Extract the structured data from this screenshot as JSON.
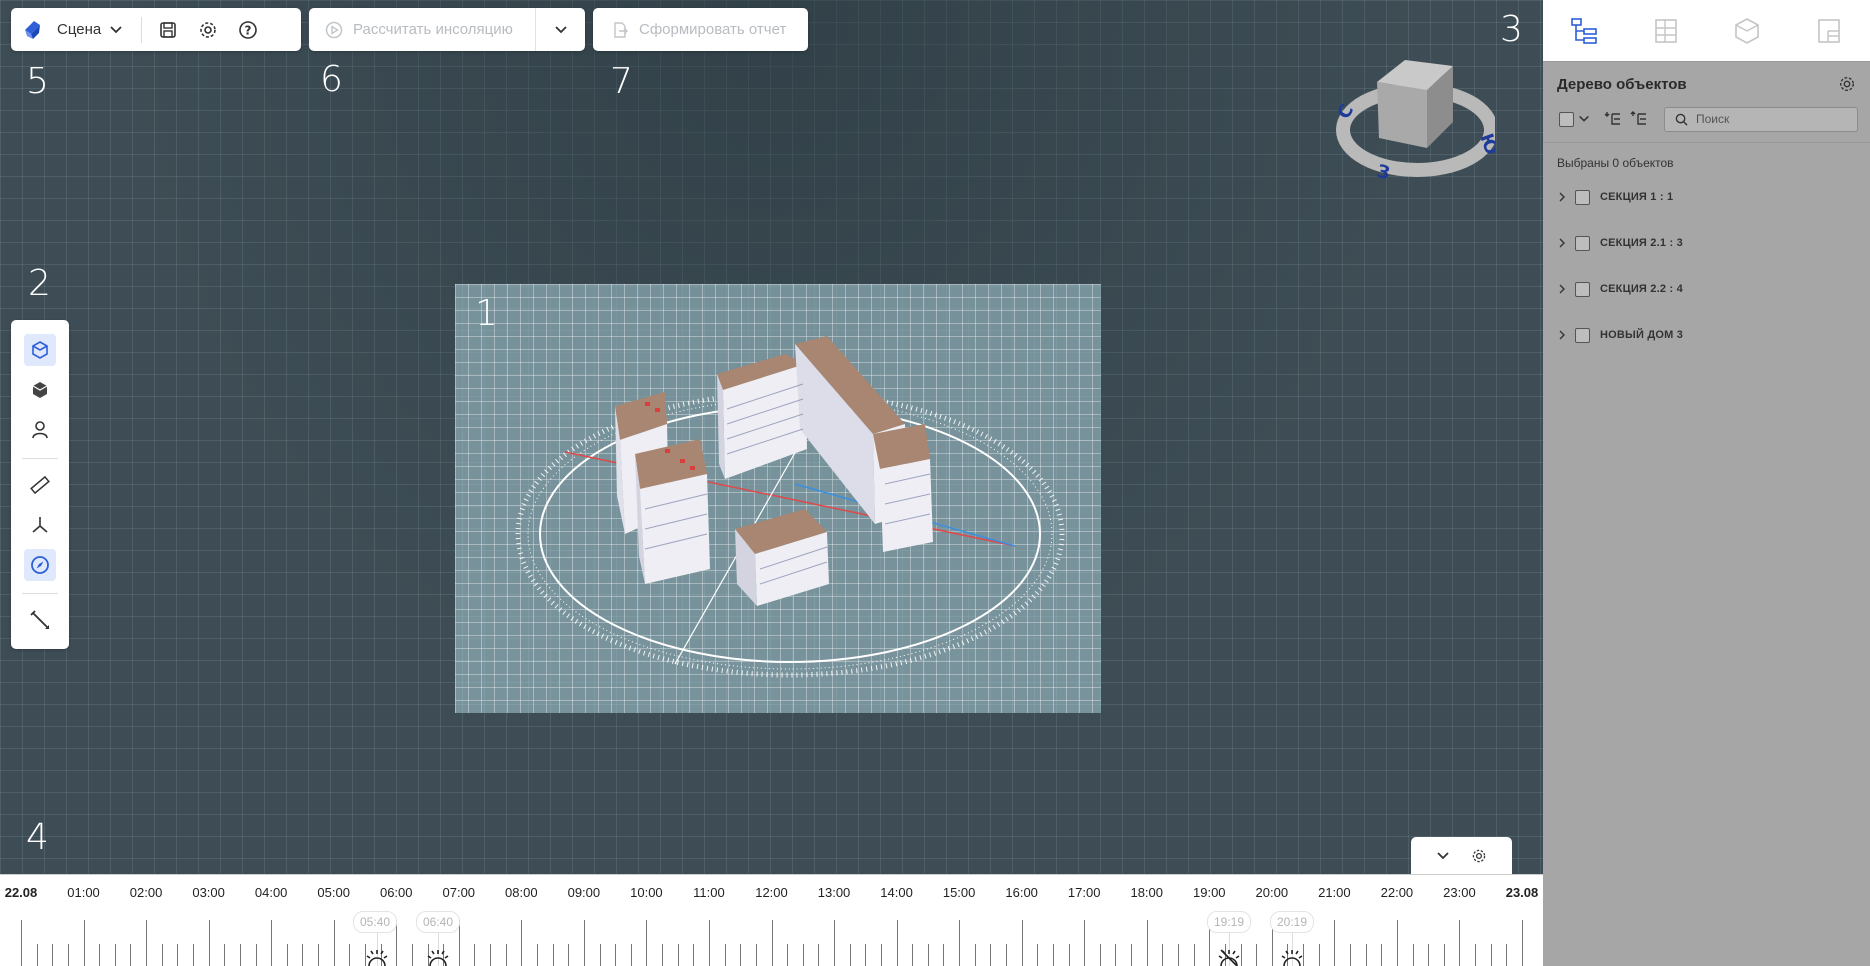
{
  "viewport": {
    "region_numbers": [
      "1",
      "2",
      "3",
      "4",
      "5",
      "6",
      "7"
    ]
  },
  "toolbar": {
    "scene_label": "Сцена",
    "insolation_label": "Рассчитать инсоляцию",
    "report_label": "Сформировать отчет"
  },
  "view_cube": {
    "labels": [
      "С",
      "Ю",
      "З"
    ]
  },
  "left_tools": [
    {
      "name": "box-select-icon",
      "active": true
    },
    {
      "name": "solid-box-icon",
      "active": false
    },
    {
      "name": "person-icon",
      "active": false
    },
    {
      "name": "ruler-icon",
      "active": false
    },
    {
      "name": "axes-icon",
      "active": false
    },
    {
      "name": "compass-icon",
      "active": true
    },
    {
      "name": "tools-icon",
      "active": false
    }
  ],
  "timeline": {
    "start_label": "22.08",
    "end_label": "23.08",
    "hours": [
      "01:00",
      "02:00",
      "03:00",
      "04:00",
      "05:00",
      "06:00",
      "07:00",
      "08:00",
      "09:00",
      "10:00",
      "11:00",
      "12:00",
      "13:00",
      "14:00",
      "15:00",
      "16:00",
      "17:00",
      "18:00",
      "19:00",
      "20:00",
      "21:00",
      "22:00",
      "23:00"
    ],
    "sun_markers": [
      "05:40",
      "06:40",
      "19:19",
      "20:19"
    ]
  },
  "panel": {
    "title": "Дерево объектов",
    "search_placeholder": "Поиск",
    "selected_count": "Выбраны 0 объектов",
    "tree_items": [
      "СЕКЦИЯ 1 : 1",
      "СЕКЦИЯ 2.1 : 3",
      "СЕКЦИЯ 2.2 : 4",
      "НОВЫЙ ДОМ 3"
    ]
  },
  "colors": {
    "accent": "#2e5fd8",
    "viewport_bg": "#3e4d55",
    "panel_bg": "#a6a6a6"
  }
}
